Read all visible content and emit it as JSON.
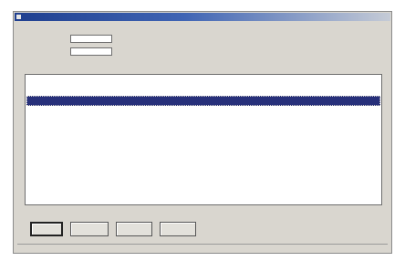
{
  "window": {
    "title": ""
  },
  "menu": [
    {
      "label": ""
    },
    {
      "label": ""
    }
  ],
  "form": {
    "field1_label": "",
    "field1_value": "",
    "field2_label": "",
    "field2_value": "",
    "info1_label": "",
    "info1_value": "",
    "info2_label": "",
    "info2_value": ""
  },
  "list": {
    "group_label": "",
    "rows": [
      {
        "name": "",
        "num": "",
        "status": "",
        "selected": false
      },
      {
        "name": "",
        "num": "",
        "status": "",
        "selected": true
      }
    ]
  },
  "buttons": [
    {
      "label": "",
      "default": true
    },
    {
      "label": ""
    },
    {
      "label": ""
    },
    {
      "label": ""
    }
  ],
  "hint_text": "",
  "status_bar": {
    "left": "",
    "right": ""
  }
}
